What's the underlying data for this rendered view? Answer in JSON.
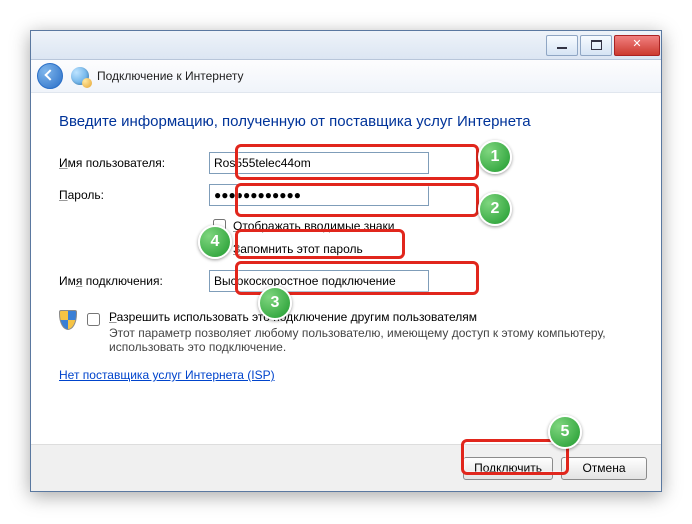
{
  "window": {
    "title": "Подключение к Интернету"
  },
  "heading": "Введите информацию, полученную от поставщика услуг Интернета",
  "labels": {
    "username_prefix": "И",
    "username_rest": "мя пользователя:",
    "password_prefix": "П",
    "password_rest": "ароль:",
    "connection_name": "Им",
    "connection_name_u": "я",
    "connection_name_rest": " подключения:"
  },
  "fields": {
    "username": "Ros555telec44om",
    "password": "●●●●●●●●●●●●",
    "connection_name": "Высокоскоростное подключение"
  },
  "checks": {
    "show_chars_u": "О",
    "show_chars_rest": "тображать вводимые знаки",
    "remember_u": "З",
    "remember_rest": "апомнить этот пароль",
    "allow_u": "Р",
    "allow_rest": "азрешить использовать это подключение другим пользователям",
    "allow_sub": "Этот параметр позволяет любому пользователю, имеющему доступ к этому компьютеру, использовать это подключение."
  },
  "link": "Нет поставщика услуг Интернета (ISP)",
  "buttons": {
    "connect": "Подключить",
    "cancel": "Отмена"
  },
  "badges": {
    "b1": "1",
    "b2": "2",
    "b3": "3",
    "b4": "4",
    "b5": "5"
  }
}
